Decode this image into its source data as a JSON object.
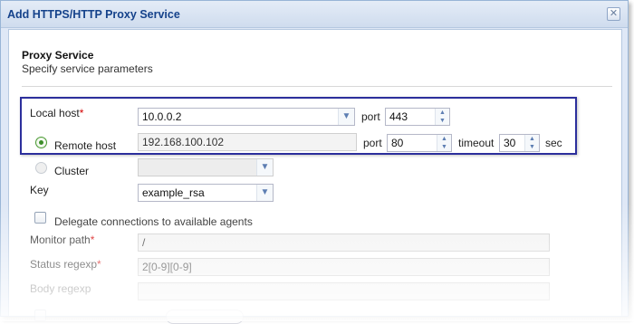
{
  "dialog": {
    "title": "Add HTTPS/HTTP Proxy Service",
    "close_icon": "close-icon"
  },
  "section": {
    "title": "Proxy Service",
    "subtitle": "Specify service parameters"
  },
  "local_host": {
    "label": "Local host",
    "required": "*",
    "value": "10.0.0.2",
    "port_label": "port",
    "port_value": "443"
  },
  "remote_host": {
    "label": "Remote host",
    "selected": true,
    "value": "192.168.100.102",
    "port_label": "port",
    "port_value": "80",
    "timeout_label": "timeout",
    "timeout_value": "30",
    "sec_label": "sec"
  },
  "cluster": {
    "label": "Cluster",
    "selected": false,
    "value": ""
  },
  "key": {
    "label": "Key",
    "value": "example_rsa"
  },
  "delegate": {
    "label": "Delegate connections to available agents",
    "checked": false
  },
  "monitor_path": {
    "label": "Monitor path",
    "required": "*",
    "value": "/"
  },
  "status_regexp": {
    "label": "Status regexp",
    "required": "*",
    "value": "2[0-9][0-9]"
  },
  "body_regexp": {
    "label": "Body regexp",
    "value": ""
  },
  "colors": {
    "title_text": "#15428b",
    "highlight_border": "#2c2f9c",
    "required_mark": "#d40000",
    "radio_checked": "#3d8e2a"
  }
}
